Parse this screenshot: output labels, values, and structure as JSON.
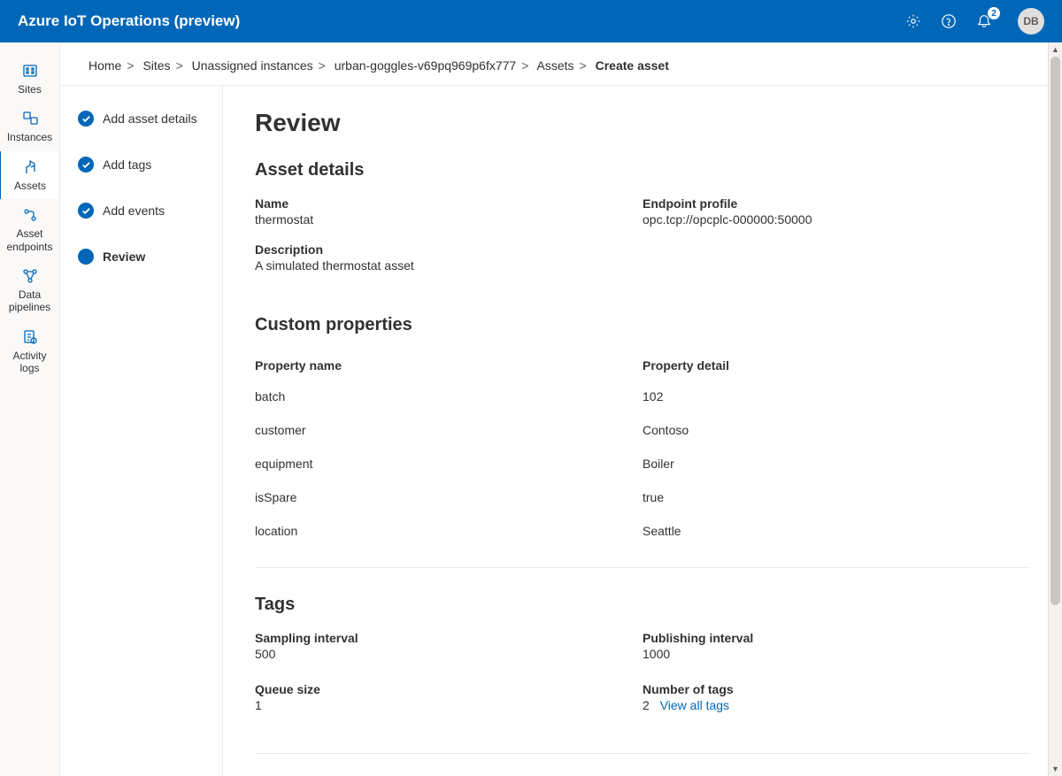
{
  "header": {
    "title": "Azure IoT Operations (preview)",
    "notification_count": "2",
    "avatar_initials": "DB"
  },
  "left_nav": [
    {
      "label": "Sites"
    },
    {
      "label": "Instances"
    },
    {
      "label": "Assets"
    },
    {
      "label": "Asset endpoints"
    },
    {
      "label": "Data pipelines"
    },
    {
      "label": "Activity logs"
    }
  ],
  "breadcrumb": {
    "items": [
      "Home",
      "Sites",
      "Unassigned instances",
      "urban-goggles-v69pq969p6fx777",
      "Assets"
    ],
    "current": "Create asset"
  },
  "steps": [
    {
      "label": "Add asset details",
      "state": "done"
    },
    {
      "label": "Add tags",
      "state": "done"
    },
    {
      "label": "Add events",
      "state": "done"
    },
    {
      "label": "Review",
      "state": "current"
    }
  ],
  "review": {
    "title": "Review",
    "asset_details": {
      "heading": "Asset details",
      "name_label": "Name",
      "name_value": "thermostat",
      "endpoint_label": "Endpoint profile",
      "endpoint_value": "opc.tcp://opcplc-000000:50000",
      "description_label": "Description",
      "description_value": "A simulated thermostat asset"
    },
    "custom_properties": {
      "heading": "Custom properties",
      "col1_header": "Property name",
      "col2_header": "Property detail",
      "rows": [
        {
          "name": "batch",
          "detail": "102"
        },
        {
          "name": "customer",
          "detail": "Contoso"
        },
        {
          "name": "equipment",
          "detail": "Boiler"
        },
        {
          "name": "isSpare",
          "detail": "true"
        },
        {
          "name": "location",
          "detail": "Seattle"
        }
      ]
    },
    "tags": {
      "heading": "Tags",
      "sampling_label": "Sampling interval",
      "sampling_value": "500",
      "publishing_label": "Publishing interval",
      "publishing_value": "1000",
      "queue_label": "Queue size",
      "queue_value": "1",
      "count_label": "Number of tags",
      "count_value": "2",
      "view_all_label": "View all tags"
    }
  }
}
